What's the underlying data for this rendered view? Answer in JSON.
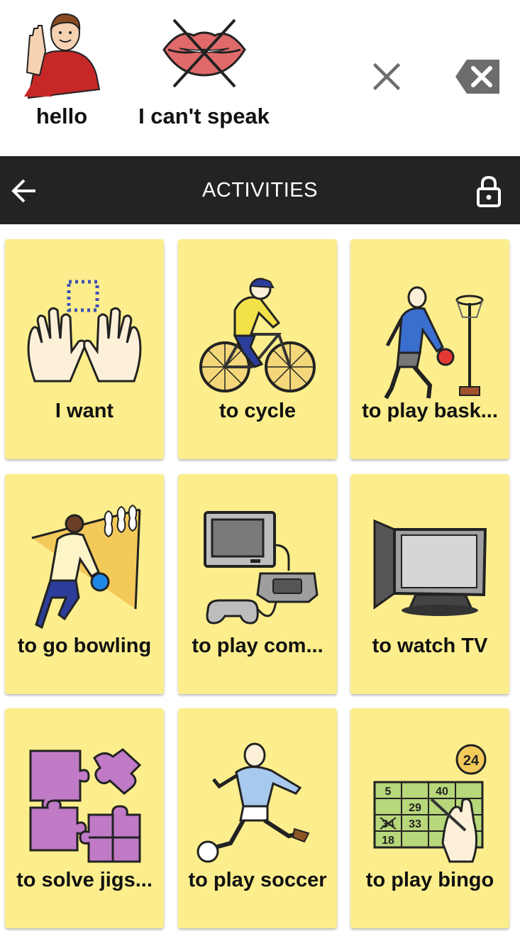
{
  "sentence_bar": {
    "phrases": [
      {
        "label": "hello",
        "icon": "waving-person-icon"
      },
      {
        "label": "I can't speak",
        "icon": "crossed-lips-icon"
      }
    ],
    "clear_icon": "close-icon",
    "backspace_icon": "backspace-icon"
  },
  "header": {
    "title": "ACTIVITIES",
    "back_icon": "arrow-left-icon",
    "lock_icon": "lock-icon"
  },
  "colors": {
    "header_bg": "#232323",
    "tile_bg": "#fcee8c",
    "text": "#111111"
  },
  "tiles": [
    {
      "label": "I want",
      "icon": "hands-reaching-icon"
    },
    {
      "label": "to cycle",
      "icon": "bicycle-rider-icon"
    },
    {
      "label": "to play bask...",
      "icon": "basketball-player-icon"
    },
    {
      "label": "to go bowling",
      "icon": "bowling-icon"
    },
    {
      "label": "to play com...",
      "icon": "game-console-icon"
    },
    {
      "label": "to watch TV",
      "icon": "television-icon"
    },
    {
      "label": "to solve jigs...",
      "icon": "jigsaw-puzzle-icon"
    },
    {
      "label": "to play soccer",
      "icon": "soccer-player-icon"
    },
    {
      "label": "to play bingo",
      "icon": "bingo-card-icon"
    }
  ],
  "bingo_numbers": [
    "5",
    "40",
    "29",
    "34",
    "33",
    "18",
    "24"
  ]
}
